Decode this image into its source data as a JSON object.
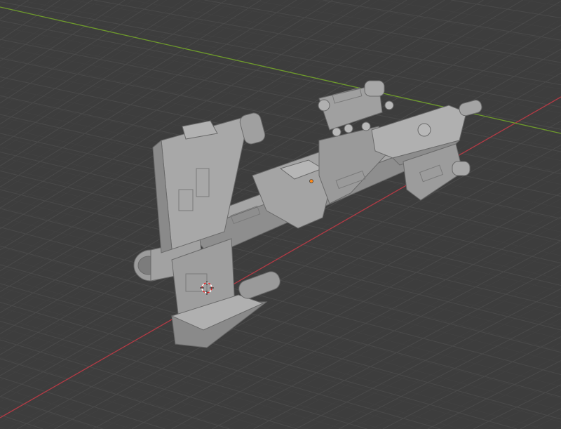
{
  "viewport": {
    "background": "#3d3d3d",
    "grid_color": "#4a4a4a",
    "grid_minor_color": "#434343",
    "x_axis_color": "#b33a44",
    "y_axis_color": "#6e9a2c"
  },
  "scene": {
    "object": "spaceship-model",
    "object_color": "#9a9a9a",
    "origin_color": "#ff8a1a",
    "cursor_icon": "3d-cursor-icon"
  }
}
